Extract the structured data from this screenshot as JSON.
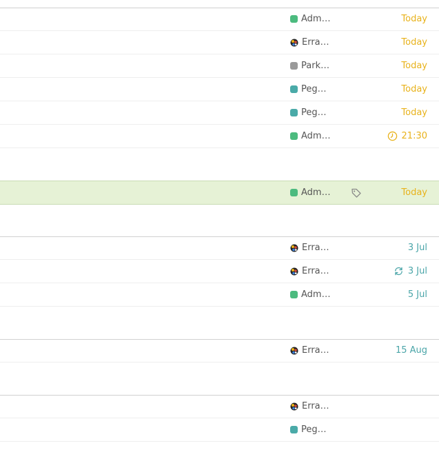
{
  "colors": {
    "today": "#e8b21a",
    "future": "#4aa5a8",
    "green": "#4cbb7f",
    "gray": "#9a9a9a",
    "teal": "#4aaaa8",
    "selected_bg": "#e6f2d6"
  },
  "rows": [
    {
      "project": "Adm…",
      "project_icon": "green-swatch",
      "date": "Today",
      "date_kind": "today"
    },
    {
      "project": "Erra…",
      "project_icon": "avatar-icon",
      "date": "Today",
      "date_kind": "today"
    },
    {
      "project": "Park…",
      "project_icon": "gray-swatch",
      "date": "Today",
      "date_kind": "today"
    },
    {
      "project": "Peg…",
      "project_icon": "teal-swatch",
      "date": "Today",
      "date_kind": "today"
    },
    {
      "project": "Peg…",
      "project_icon": "teal-swatch",
      "date": "Today",
      "date_kind": "today"
    },
    {
      "project": "Adm…",
      "project_icon": "green-swatch",
      "date": "21:30",
      "date_kind": "today",
      "date_icon": "clock-icon"
    },
    {
      "project": "Adm…",
      "project_icon": "green-swatch",
      "date": "Today",
      "date_kind": "today",
      "tag_icon": "tag-icon",
      "selected": true
    },
    {
      "project": "Erra…",
      "project_icon": "avatar-icon",
      "date": "3 Jul",
      "date_kind": "future"
    },
    {
      "project": "Erra…",
      "project_icon": "avatar-icon",
      "date": "3 Jul",
      "date_kind": "future",
      "date_icon": "repeat-icon"
    },
    {
      "project": "Adm…",
      "project_icon": "green-swatch",
      "date": "5 Jul",
      "date_kind": "future"
    },
    {
      "project": "Erra…",
      "project_icon": "avatar-icon",
      "date": "15 Aug",
      "date_kind": "future"
    },
    {
      "project": "Erra…",
      "project_icon": "avatar-icon",
      "date": "",
      "date_kind": "future"
    },
    {
      "project": "Peg…",
      "project_icon": "teal-swatch",
      "date": "",
      "date_kind": "future"
    }
  ]
}
